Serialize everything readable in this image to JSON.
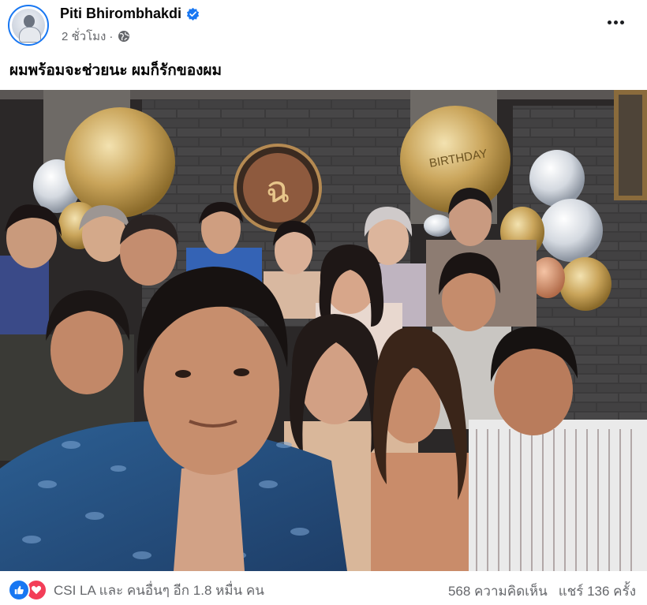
{
  "post": {
    "author": "Piti Bhirombhakdi",
    "time": "2 ชั่วโมง",
    "meta_separator": "·",
    "caption": "ผมพร้อมจะช่วยนะ ผมก็รักของผม",
    "icons": {
      "verified": "verified-badge-icon",
      "audience": "globe-icon",
      "more": "more-options-icon"
    },
    "colors": {
      "brand": "#1877f2",
      "like": "#1877f2",
      "love": "#f33e58",
      "secondary_text": "#65676b"
    }
  },
  "photo": {
    "sign_text": "BIRTHDAY",
    "logo_glyph": "ฉ"
  },
  "footer": {
    "reactions_text": "CSI LA และ คนอื่นๆ อีก 1.8 หมื่น คน",
    "comments": "568 ความคิดเห็น",
    "shares": "แชร์ 136 ครั้ง"
  }
}
